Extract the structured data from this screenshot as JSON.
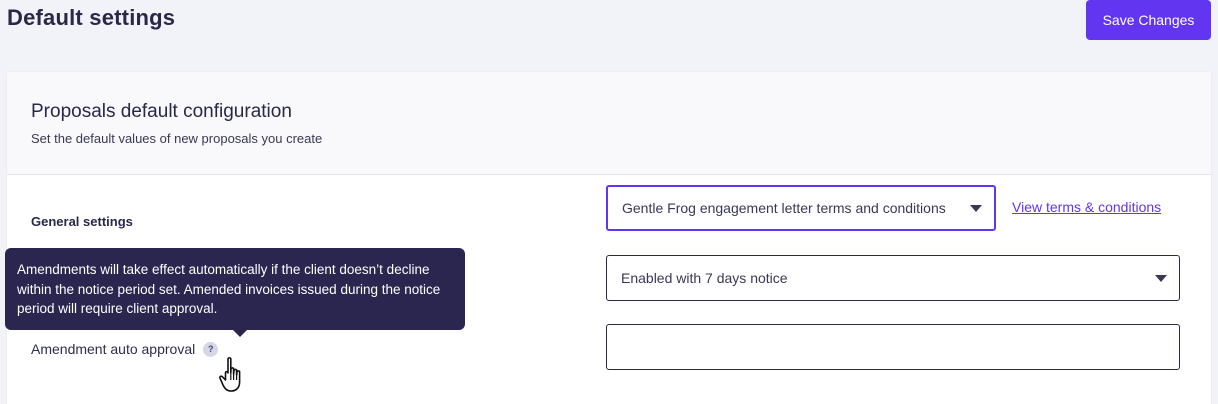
{
  "header": {
    "title": "Default settings",
    "save_label": "Save Changes"
  },
  "card": {
    "title": "Proposals default configuration",
    "subtitle": "Set the default values of new proposals you create"
  },
  "general": {
    "section_title": "General settings",
    "terms": {
      "value": "Gentle Frog engagement letter terms and conditions",
      "link_label": "View terms & conditions"
    },
    "amendment": {
      "label": "Amendment auto approval",
      "help_glyph": "?",
      "value": "Enabled with 7 days notice",
      "tooltip": "Amendments will take effect automatically if the client doesn’t decline within the notice period set. Amended invoices issued during the notice period will require client approval."
    }
  },
  "colors": {
    "accent": "#6235f0",
    "tooltip_bg": "#2b2650",
    "title_text": "#2a2848"
  },
  "icons": {
    "help": "help-icon",
    "caret": "caret-down-icon",
    "pointer": "hand-pointer-icon"
  }
}
